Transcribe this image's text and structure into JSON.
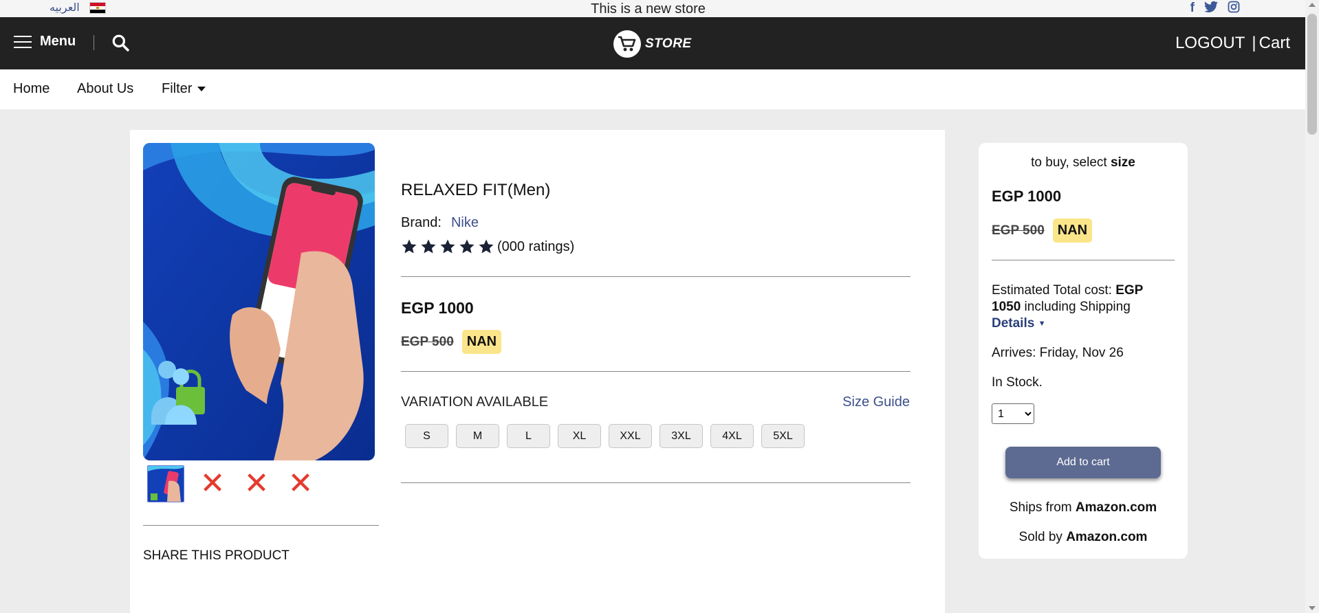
{
  "topbar": {
    "language_label": "العربيه",
    "notice": "This is a new store",
    "social_icons": [
      "facebook-icon",
      "twitter-icon",
      "instagram-icon"
    ]
  },
  "header": {
    "menu_label": "Menu",
    "logo_text": "STORE",
    "logout_label": "LOGOUT",
    "cart_separator": "|",
    "cart_label": "Cart"
  },
  "nav": {
    "items": [
      "Home",
      "About Us",
      "Filter"
    ]
  },
  "product": {
    "title": "RELAXED FIT(Men)",
    "brand_label": "Brand:",
    "brand_name": "Nike",
    "stars": 5,
    "ratings_text": "(000 ratings)",
    "price": "EGP 1000",
    "old_price": "EGP 500",
    "discount_badge": "NAN",
    "variation_label": "VARIATION AVAILABLE",
    "size_guide_label": "Size Guide",
    "sizes": [
      "S",
      "M",
      "L",
      "XL",
      "XXL",
      "3XL",
      "4XL",
      "5XL"
    ],
    "share_label": "SHARE THIS PRODUCT"
  },
  "buybox": {
    "hint_prefix": "to buy, select ",
    "hint_bold": "size",
    "price": "EGP 1000",
    "old_price": "EGP 500",
    "discount_badge": "NAN",
    "est_prefix": "Estimated Total cost: ",
    "est_amount": "EGP 1050",
    "est_suffix": " including Shipping",
    "details_label": "Details",
    "arrives": "Arrives: Friday, Nov 26",
    "stock": "In Stock.",
    "quantity": "1",
    "add_to_cart": "Add to cart",
    "ships_prefix": "Ships from ",
    "ships_from": "Amazon.com",
    "sold_prefix": "Sold by ",
    "sold_by": "Amazon.com"
  },
  "colors": {
    "header_bg": "#222222",
    "link": "#3b4f8a",
    "badge_bg": "#fbe58a",
    "add_to_cart_bg": "#5d6a91",
    "remove_icon": "#e43a2e"
  }
}
